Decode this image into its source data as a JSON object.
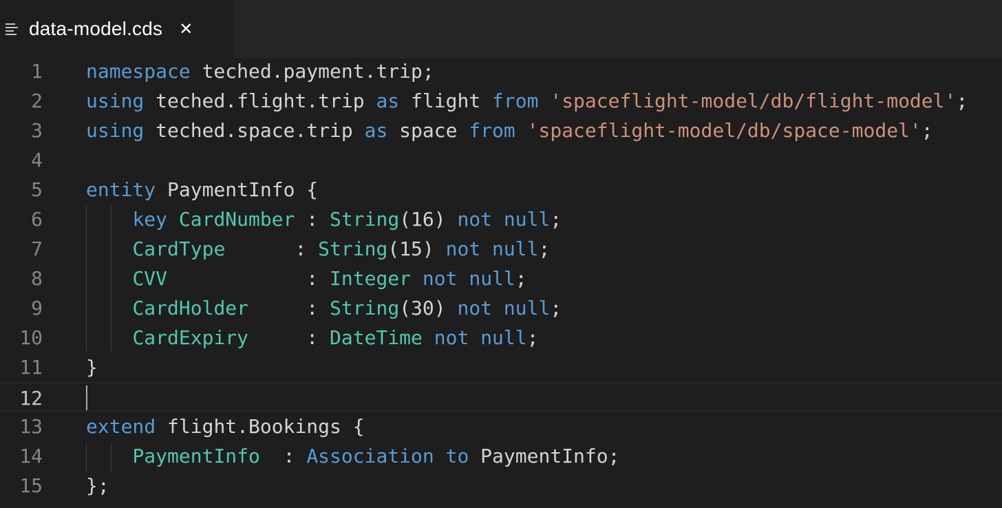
{
  "tab": {
    "filename": "data-model.cds",
    "icon": "file-lines-icon",
    "close_symbol": "✕"
  },
  "colors": {
    "background": "#1e1e1e",
    "keyword": "#569cd6",
    "type": "#4ec9b0",
    "string": "#ce9178",
    "text": "#d4d4d4",
    "line_number": "#858585"
  },
  "editor": {
    "current_line": 12,
    "lines": [
      {
        "n": "1",
        "tokens": [
          {
            "t": "namespace",
            "c": "kw"
          },
          {
            "t": " teched.payment.trip;",
            "c": "pl"
          }
        ]
      },
      {
        "n": "2",
        "tokens": [
          {
            "t": "using",
            "c": "kw"
          },
          {
            "t": " ",
            "c": "pl"
          },
          {
            "t": "teched.flight.trip",
            "c": "pl"
          },
          {
            "t": " ",
            "c": "pl"
          },
          {
            "t": "as",
            "c": "kw"
          },
          {
            "t": " ",
            "c": "pl"
          },
          {
            "t": "flight",
            "c": "pl"
          },
          {
            "t": " ",
            "c": "pl"
          },
          {
            "t": "from",
            "c": "kw"
          },
          {
            "t": " ",
            "c": "pl"
          },
          {
            "t": "'spaceflight-model/db/flight-model'",
            "c": "str"
          },
          {
            "t": ";",
            "c": "pl"
          }
        ]
      },
      {
        "n": "3",
        "tokens": [
          {
            "t": "using",
            "c": "kw"
          },
          {
            "t": " ",
            "c": "pl"
          },
          {
            "t": "teched.space.trip",
            "c": "pl"
          },
          {
            "t": " ",
            "c": "pl"
          },
          {
            "t": "as",
            "c": "kw"
          },
          {
            "t": " ",
            "c": "pl"
          },
          {
            "t": "space",
            "c": "pl"
          },
          {
            "t": " ",
            "c": "pl"
          },
          {
            "t": "from",
            "c": "kw"
          },
          {
            "t": " ",
            "c": "pl"
          },
          {
            "t": "'spaceflight-model/db/space-model'",
            "c": "str"
          },
          {
            "t": ";",
            "c": "pl"
          }
        ]
      },
      {
        "n": "4",
        "tokens": []
      },
      {
        "n": "5",
        "tokens": [
          {
            "t": "entity",
            "c": "kw"
          },
          {
            "t": " PaymentInfo {",
            "c": "pl"
          }
        ]
      },
      {
        "n": "6",
        "tokens": [
          {
            "t": "    ",
            "c": "pl"
          },
          {
            "t": "key",
            "c": "kw"
          },
          {
            "t": " ",
            "c": "pl"
          },
          {
            "t": "CardNumber",
            "c": "typ"
          },
          {
            "t": " : ",
            "c": "pl"
          },
          {
            "t": "String",
            "c": "typ"
          },
          {
            "t": "(16) ",
            "c": "pl"
          },
          {
            "t": "not",
            "c": "kw"
          },
          {
            "t": " ",
            "c": "pl"
          },
          {
            "t": "null",
            "c": "kw"
          },
          {
            "t": ";",
            "c": "pl"
          }
        ]
      },
      {
        "n": "7",
        "tokens": [
          {
            "t": "    ",
            "c": "pl"
          },
          {
            "t": "CardType",
            "c": "typ"
          },
          {
            "t": "      : ",
            "c": "pl"
          },
          {
            "t": "String",
            "c": "typ"
          },
          {
            "t": "(15) ",
            "c": "pl"
          },
          {
            "t": "not",
            "c": "kw"
          },
          {
            "t": " ",
            "c": "pl"
          },
          {
            "t": "null",
            "c": "kw"
          },
          {
            "t": ";",
            "c": "pl"
          }
        ]
      },
      {
        "n": "8",
        "tokens": [
          {
            "t": "    ",
            "c": "pl"
          },
          {
            "t": "CVV",
            "c": "typ"
          },
          {
            "t": "            : ",
            "c": "pl"
          },
          {
            "t": "Integer",
            "c": "typ"
          },
          {
            "t": " ",
            "c": "pl"
          },
          {
            "t": "not",
            "c": "kw"
          },
          {
            "t": " ",
            "c": "pl"
          },
          {
            "t": "null",
            "c": "kw"
          },
          {
            "t": ";",
            "c": "pl"
          }
        ]
      },
      {
        "n": "9",
        "tokens": [
          {
            "t": "    ",
            "c": "pl"
          },
          {
            "t": "CardHolder",
            "c": "typ"
          },
          {
            "t": "     : ",
            "c": "pl"
          },
          {
            "t": "String",
            "c": "typ"
          },
          {
            "t": "(30) ",
            "c": "pl"
          },
          {
            "t": "not",
            "c": "kw"
          },
          {
            "t": " ",
            "c": "pl"
          },
          {
            "t": "null",
            "c": "kw"
          },
          {
            "t": ";",
            "c": "pl"
          }
        ]
      },
      {
        "n": "10",
        "tokens": [
          {
            "t": "    ",
            "c": "pl"
          },
          {
            "t": "CardExpiry",
            "c": "typ"
          },
          {
            "t": "     : ",
            "c": "pl"
          },
          {
            "t": "DateTime",
            "c": "typ"
          },
          {
            "t": " ",
            "c": "pl"
          },
          {
            "t": "not",
            "c": "kw"
          },
          {
            "t": " ",
            "c": "pl"
          },
          {
            "t": "null",
            "c": "kw"
          },
          {
            "t": ";",
            "c": "pl"
          }
        ]
      },
      {
        "n": "11",
        "tokens": [
          {
            "t": "}",
            "c": "pl"
          }
        ]
      },
      {
        "n": "12",
        "tokens": []
      },
      {
        "n": "13",
        "tokens": [
          {
            "t": "extend",
            "c": "kw"
          },
          {
            "t": " flight.Bookings {",
            "c": "pl"
          }
        ]
      },
      {
        "n": "14",
        "tokens": [
          {
            "t": "    ",
            "c": "pl"
          },
          {
            "t": "PaymentInfo",
            "c": "typ"
          },
          {
            "t": "  : ",
            "c": "pl"
          },
          {
            "t": "Association",
            "c": "kw"
          },
          {
            "t": " ",
            "c": "pl"
          },
          {
            "t": "to",
            "c": "kw"
          },
          {
            "t": " PaymentInfo;",
            "c": "pl"
          }
        ]
      },
      {
        "n": "15",
        "tokens": [
          {
            "t": "};",
            "c": "pl"
          }
        ]
      }
    ]
  }
}
